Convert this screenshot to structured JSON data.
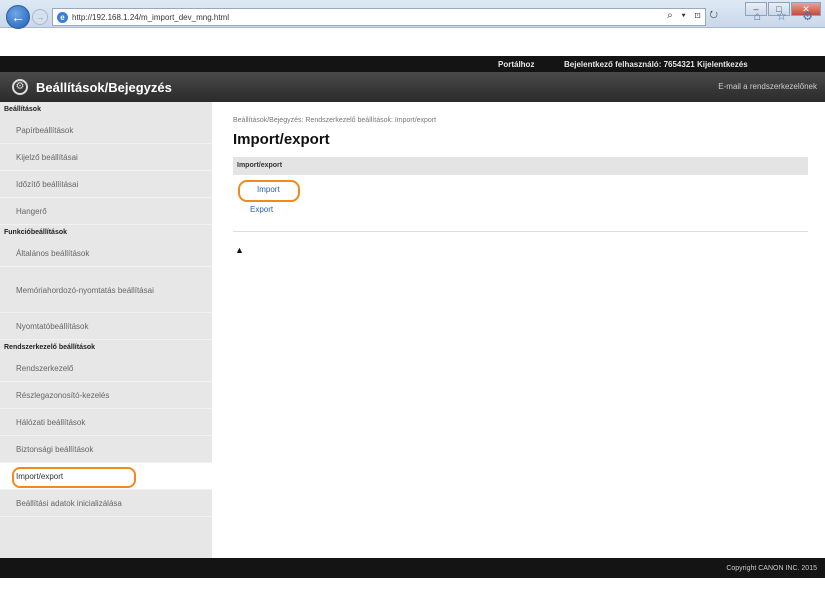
{
  "browser": {
    "url": "http://192.168.1.24/m_import_dev_mng.html",
    "address_actions": "⌕ ▾ ⊡ ↻",
    "toolbar_icons": "⌂ ☆ ⚙",
    "window_buttons": [
      "–",
      "□",
      "✕"
    ]
  },
  "topbar": {
    "portal": "Portálhoz",
    "login_label": "Bejelentkező felhasználó:  7654321  Kijelentkezés",
    "logo": ""
  },
  "header": {
    "title": "Beállítások/Bejegyzés",
    "email_admin": "E-mail a rendszerkezelőnek"
  },
  "sidebar": {
    "sections": [
      {
        "title": "Beállítások",
        "items": [
          "Papírbeállítások",
          "Kijelző beállításai",
          "Időzítő beállításai",
          "Hangerő"
        ]
      },
      {
        "title": "Funkcióbeállítások",
        "items": [
          "Általános beállítások",
          "Memóriahordozó-nyomtatás beállításai",
          "Nyomtatóbeállítások"
        ]
      },
      {
        "title": "Rendszerkezelő beállítások",
        "items": [
          "Rendszerkezelő",
          "Részlegazonosító-kezelés",
          "Hálózati beállítások",
          "Biztonsági beállítások",
          "Import/export",
          "Beállítási adatok inicializálása"
        ]
      }
    ],
    "active_item": "Import/export"
  },
  "main": {
    "breadcrumb": "Beállítások/Bejegyzés: Rendszerkezelő beállítások: Import/export",
    "title": "Import/export",
    "section_header": "Import/export",
    "links": [
      "Import",
      "Export"
    ],
    "top_link": "▲"
  },
  "footer": {
    "copyright": "Copyright CANON INC. 2015"
  },
  "colors": {
    "highlight": "#f08a1c",
    "link": "#2a5db0"
  }
}
